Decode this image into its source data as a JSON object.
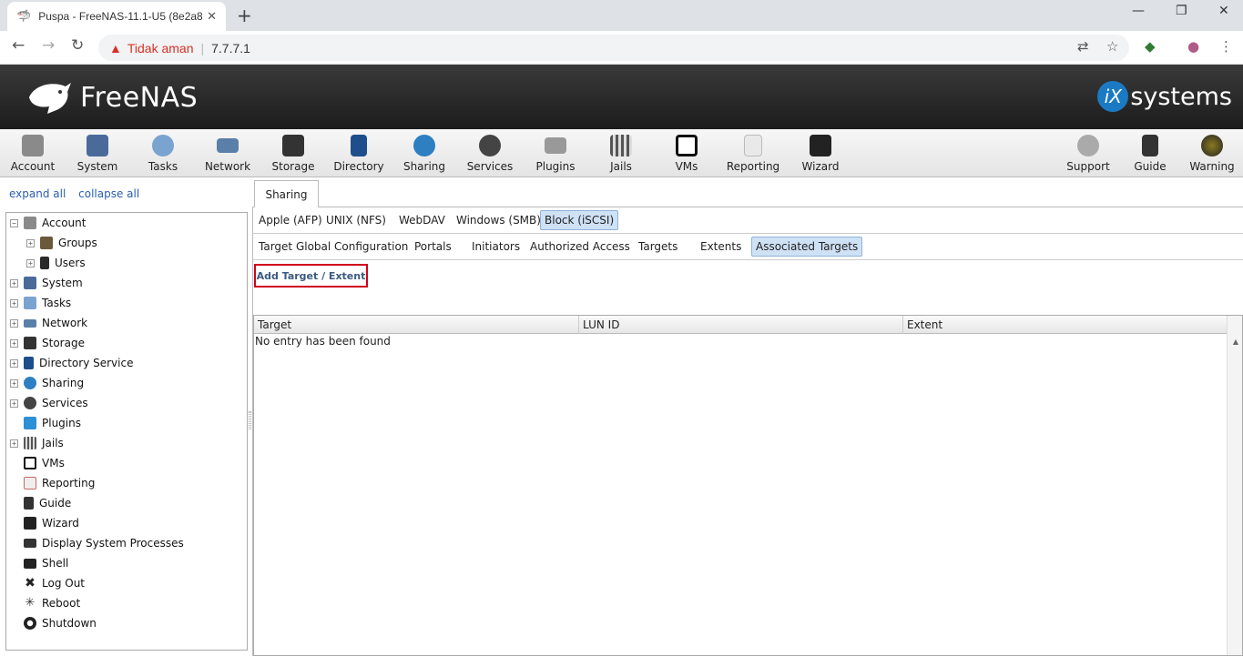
{
  "browser": {
    "tab_title": "Puspa - FreeNAS-11.1-U5 (8e2a8",
    "not_secure": "Tidak aman",
    "url": "7.7.7.1"
  },
  "header": {
    "logo_text": "FreeNAS",
    "vendor_text": "systems",
    "vendor_badge": "iX"
  },
  "toolbar": {
    "items": [
      "Account",
      "System",
      "Tasks",
      "Network",
      "Storage",
      "Directory",
      "Sharing",
      "Services",
      "Plugins",
      "Jails",
      "VMs",
      "Reporting",
      "Wizard",
      "Support",
      "Guide",
      "Warning"
    ]
  },
  "sidebar": {
    "expand_all": "expand all",
    "collapse_all": "collapse all",
    "items": [
      "Account",
      "Groups",
      "Users",
      "System",
      "Tasks",
      "Network",
      "Storage",
      "Directory Service",
      "Sharing",
      "Services",
      "Plugins",
      "Jails",
      "VMs",
      "Reporting",
      "Guide",
      "Wizard",
      "Display System Processes",
      "Shell",
      "Log Out",
      "Reboot",
      "Shutdown"
    ]
  },
  "main": {
    "tab": "Sharing",
    "share_tabs": [
      "Apple (AFP)",
      "UNIX (NFS)",
      "WebDAV",
      "Windows (SMB)",
      "Block (iSCSI)"
    ],
    "iscsi_tabs": [
      "Target Global Configuration",
      "Portals",
      "Initiators",
      "Authorized Access",
      "Targets",
      "Extents",
      "Associated Targets"
    ],
    "add_button": "Add Target / Extent",
    "columns": [
      "Target",
      "LUN ID",
      "Extent"
    ],
    "empty_text": "No entry has been found"
  },
  "colors": {
    "accent": "#2a5db0",
    "highlight_border": "#d0021b",
    "active_tab": "#cfe1f5"
  }
}
